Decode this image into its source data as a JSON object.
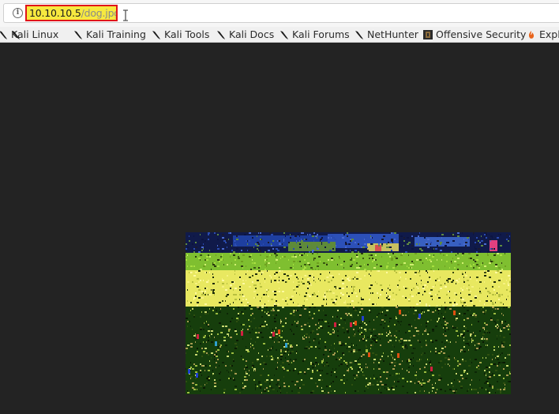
{
  "address_bar": {
    "url_host": "10.10.10.5",
    "url_path": "/dog.jpg",
    "info_icon": "info-circle-icon",
    "highlight_color": "#f7e93f",
    "highlight_border_color": "#e0151a"
  },
  "bookmarks": [
    {
      "label": "Kali Linux",
      "icon": "kali-dragon-icon"
    },
    {
      "label": "Kali Training",
      "icon": "kali-dragon-icon"
    },
    {
      "label": "Kali Tools",
      "icon": "kali-dragon-icon"
    },
    {
      "label": "Kali Docs",
      "icon": "kali-dragon-icon"
    },
    {
      "label": "Kali Forums",
      "icon": "kali-dragon-icon"
    },
    {
      "label": "NetHunter",
      "icon": "kali-dragon-icon"
    },
    {
      "label": "Offensive Security",
      "icon": "offsec-icon"
    },
    {
      "label": "Explo",
      "icon": "exploit-db-icon"
    }
  ],
  "page": {
    "background_color": "#232323",
    "image_description_colors": [
      "#0e2a7a",
      "#9be02a",
      "#f0ee60",
      "#123a08"
    ]
  }
}
